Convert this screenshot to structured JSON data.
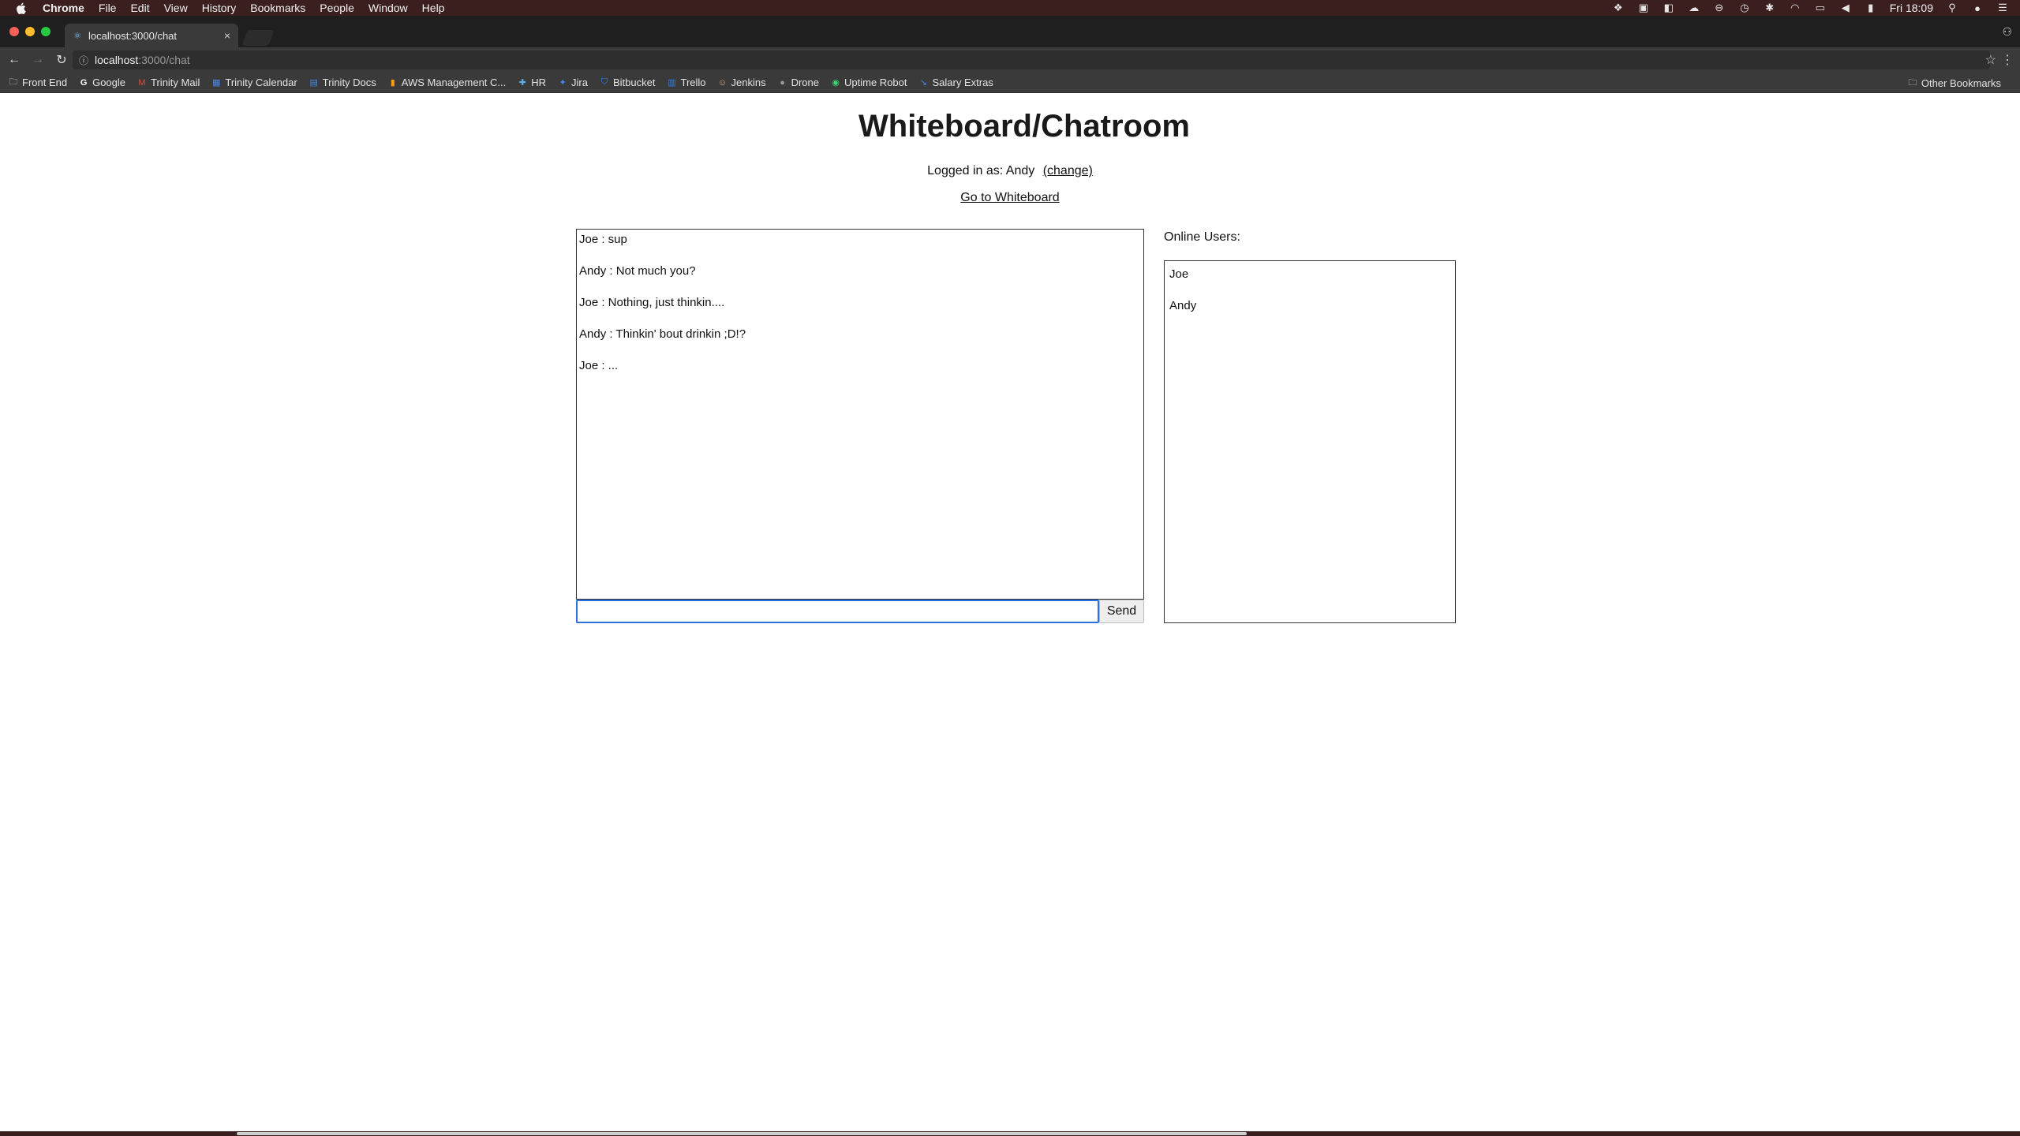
{
  "menubar": {
    "app": "Chrome",
    "items": [
      "File",
      "Edit",
      "View",
      "History",
      "Bookmarks",
      "People",
      "Window",
      "Help"
    ],
    "clock": "Fri 18:09"
  },
  "tab": {
    "title": "localhost:3000/chat",
    "close": "×"
  },
  "omnibox": {
    "host": "localhost",
    "path": ":3000/chat"
  },
  "bookmarks": {
    "items": [
      "Front End",
      "Google",
      "Trinity Mail",
      "Trinity Calendar",
      "Trinity Docs",
      "AWS Management C...",
      "HR",
      "Jira",
      "Bitbucket",
      "Trello",
      "Jenkins",
      "Drone",
      "Uptime Robot",
      "Salary Extras"
    ],
    "other": "Other Bookmarks"
  },
  "page": {
    "title": "Whiteboard/Chatroom",
    "logged_in_prefix": "Logged in as: Andy",
    "change_link": "(change)",
    "whiteboard_link": "Go to Whiteboard"
  },
  "chat": {
    "messages": [
      "Joe : sup",
      "Andy : Not much you?",
      "Joe : Nothing, just thinkin....",
      "Andy : Thinkin' bout drinkin ;D!?",
      "Joe : ..."
    ],
    "input_value": "",
    "send_label": "Send"
  },
  "users": {
    "label": "Online Users:",
    "list": [
      "Joe",
      "Andy"
    ]
  },
  "colors": {
    "menubar_bg": "#3b1f1f",
    "chrome_dark": "#3a3a3a",
    "focus_blue": "#2f6fe0"
  }
}
